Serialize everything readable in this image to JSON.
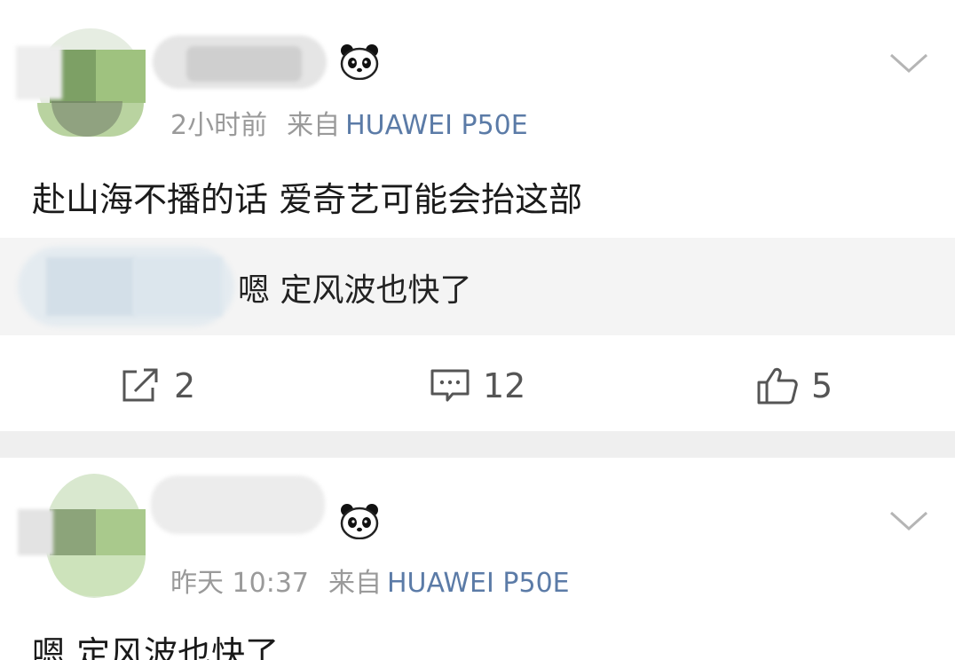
{
  "posts": [
    {
      "time": "2小时前",
      "source_prefix": "来自",
      "device": "HUAWEI P50E",
      "content": "赴山海不播的话 爱奇艺可能会抬这部",
      "quote_text": "嗯 定风波也快了",
      "actions": {
        "repost_count": "2",
        "comment_count": "12",
        "like_count": "5"
      }
    },
    {
      "time": "昨天 10:37",
      "source_prefix": "来自",
      "device": "HUAWEI P50E",
      "content": "嗯 定风波也快了"
    }
  ],
  "colors": {
    "device_link": "#5b7ba7",
    "meta_text": "#9a9a9a",
    "separator": "#efefef",
    "quote_bg": "#f4f4f4"
  },
  "icons": [
    "panda-icon",
    "chevron-down-icon",
    "repost-icon",
    "comment-icon",
    "like-icon"
  ]
}
